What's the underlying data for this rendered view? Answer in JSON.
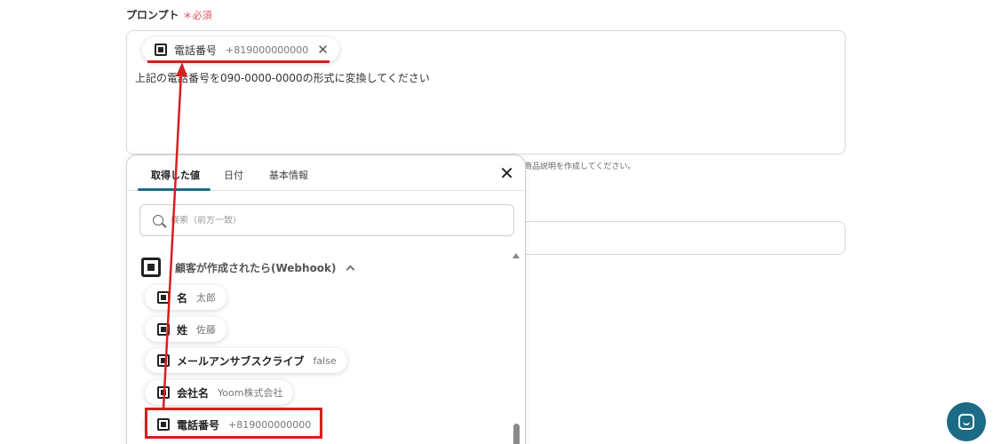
{
  "field": {
    "label": "プロンプト",
    "required": "＊必須"
  },
  "prompt": {
    "chip": {
      "name": "電話番号",
      "value": "+819000000000"
    },
    "text": "上記の電話番号を090-0000-0000の形式に変換してください"
  },
  "helper_text": "商品説明を作成してください。",
  "popup": {
    "tabs": [
      "取得した値",
      "日付",
      "基本情報"
    ],
    "search_placeholder": "検索（前方一致）",
    "group_label": "顧客が作成されたら(Webhook)",
    "items": [
      {
        "name": "名",
        "value": "太郎"
      },
      {
        "name": "姓",
        "value": "佐藤"
      },
      {
        "name": "メールアンサブスクライブ",
        "value": "false"
      },
      {
        "name": "会社名",
        "value": "Yoom株式会社"
      },
      {
        "name": "電話番号",
        "value": "+819000000000"
      }
    ]
  },
  "colors": {
    "accent": "#1b6b86",
    "highlight": "#d71f1f",
    "required": "#e0505e"
  },
  "icons": {
    "square": "square-logo-icon",
    "close": "close-icon",
    "search": "search-icon",
    "chevron": "chevron-up-icon",
    "help": "chat-help-icon"
  }
}
